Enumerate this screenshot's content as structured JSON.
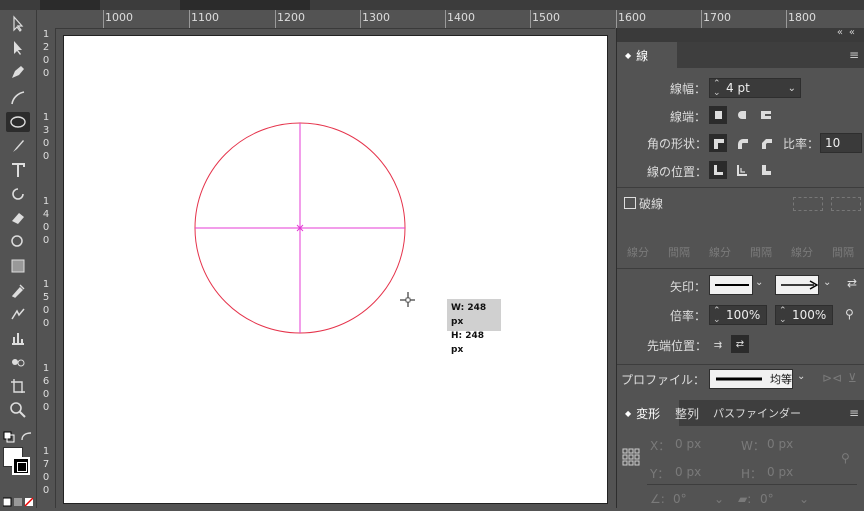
{
  "ruler": {
    "h_labels": [
      "1000",
      "1100",
      "1200",
      "1300",
      "1400",
      "1500",
      "1600",
      "1700",
      "1800"
    ],
    "v_labels": [
      "1200",
      "1300",
      "1400",
      "1500",
      "1600",
      "1700"
    ]
  },
  "tooltip": {
    "w": "W: 248 px",
    "h": "H: 248 px"
  },
  "stroke_panel": {
    "tab": "線",
    "weight_label": "線幅：",
    "weight_value": "4 pt",
    "cap_label": "線端：",
    "corner_label": "角の形状：",
    "ratio_label": "比率：",
    "ratio_value": "10",
    "align_label": "線の位置：",
    "dashed_label": "破線",
    "dash_fields": [
      "線分",
      "間隔",
      "線分",
      "間隔",
      "線分",
      "間隔"
    ],
    "arrow_label": "矢印：",
    "scale_label": "倍率：",
    "scale_start": "100%",
    "scale_end": "100%",
    "tip_label": "先端位置：",
    "profile_label": "プロファイル：",
    "profile_value": "均等"
  },
  "transform_panel": {
    "tabs": [
      "変形",
      "整列",
      "パスファインダー"
    ],
    "x_label": "X：",
    "x_value": "0 px",
    "y_label": "Y：",
    "y_value": "0 px",
    "w_label": "W：",
    "w_value": "0 px",
    "h_label": "H：",
    "h_value": "0 px",
    "angle_value": "0°",
    "shear_value": "0°"
  },
  "colors": {
    "circle_stroke": "#e5334b",
    "guide": "#e43bd6",
    "panel_bg": "#535353"
  }
}
